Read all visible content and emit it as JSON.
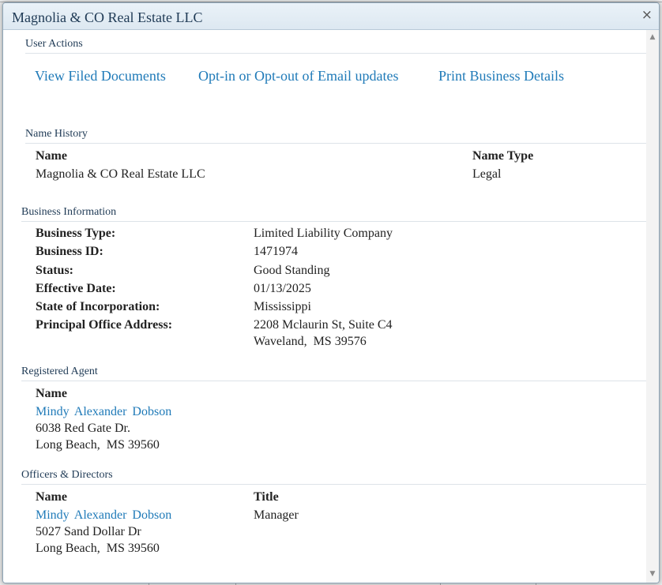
{
  "dialog": {
    "title": "Magnolia & CO Real Estate LLC",
    "close_glyph": "×"
  },
  "user_actions": {
    "heading": "User Actions",
    "links": [
      "View Filed Documents",
      "Opt-in or Opt-out of Email updates",
      "Print Business Details"
    ]
  },
  "name_history": {
    "heading": "Name History",
    "col_name": "Name",
    "col_type": "Name Type",
    "rows": [
      {
        "name": "Magnolia & CO Real Estate LLC",
        "type": "Legal"
      }
    ]
  },
  "business_info": {
    "heading": "Business Information",
    "fields": [
      {
        "label": "Business Type:",
        "value": "Limited Liability Company"
      },
      {
        "label": "Business ID:",
        "value": "1471974"
      },
      {
        "label": "Status:",
        "value": "Good Standing"
      },
      {
        "label": "Effective Date:",
        "value": "01/13/2025"
      },
      {
        "label": "State of Incorporation:",
        "value": "Mississippi"
      },
      {
        "label": "Principal Office Address:",
        "value": "2208 Mclaurin St, Suite C4",
        "value2": "Waveland,  MS 39576"
      }
    ]
  },
  "registered_agent": {
    "heading": "Registered Agent",
    "col_name": "Name",
    "name": "Mindy Alexander Dobson",
    "address1": "6038 Red Gate Dr.",
    "address2": "Long Beach,  MS 39560"
  },
  "officers": {
    "heading": "Officers & Directors",
    "col_name": "Name",
    "col_title": "Title",
    "rows": [
      {
        "name": "Mindy Alexander Dobson",
        "address1": "5027 Sand Dollar Dr",
        "address2": "Long Beach,  MS 39560",
        "title": "Manager"
      }
    ]
  },
  "colors": {
    "link": "#1f7ab8",
    "heading": "#1f3a55",
    "titlebar": "#dde8f1"
  },
  "icons": {
    "close": "close-icon",
    "scroll_up": "scroll-up-arrow-icon",
    "scroll_down": "scroll-down-arrow-icon"
  }
}
